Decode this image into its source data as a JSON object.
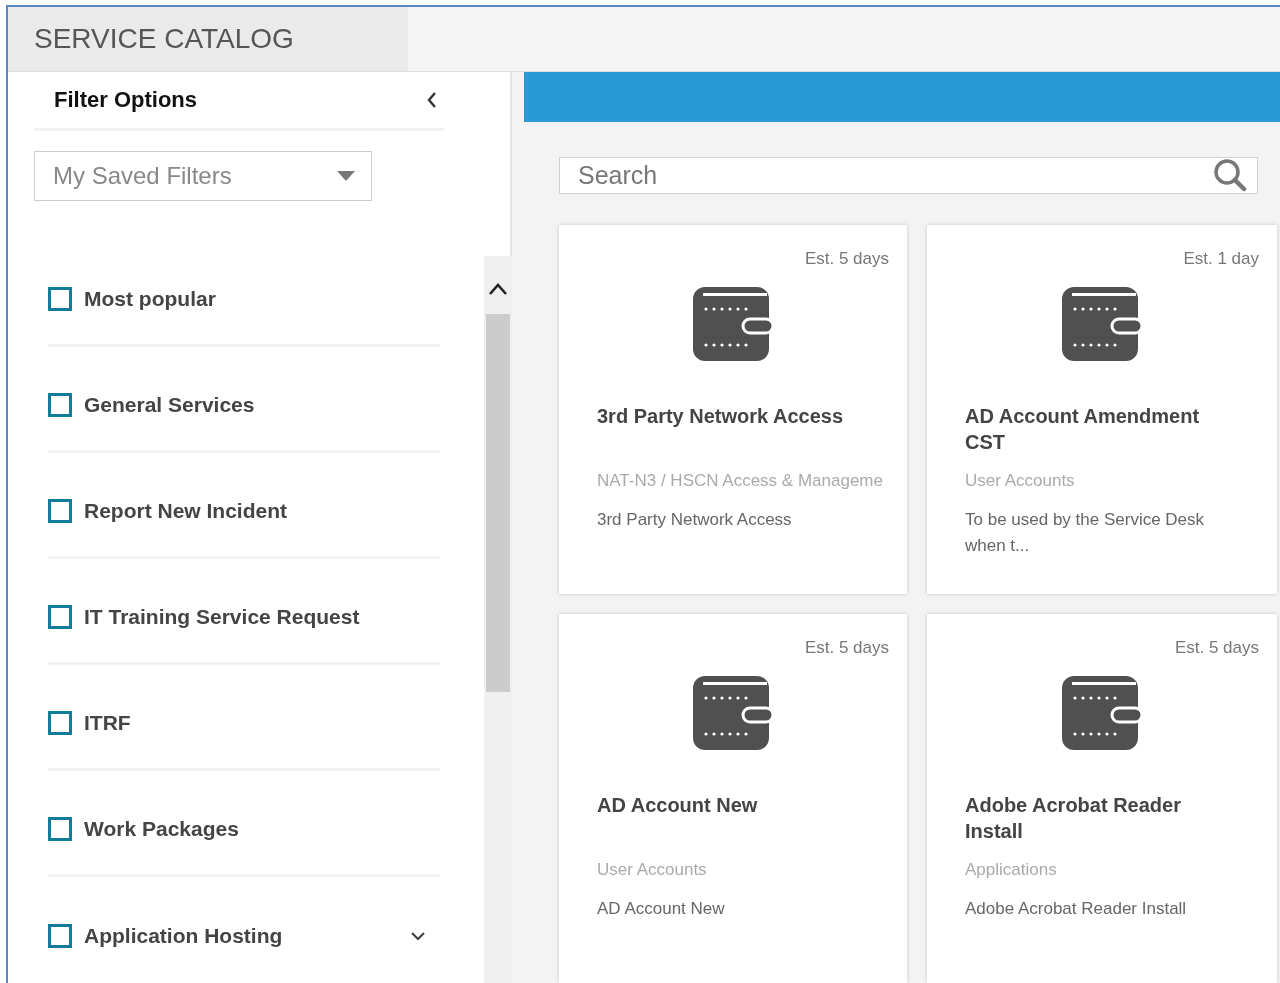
{
  "header": {
    "title": "SERVICE CATALOG"
  },
  "filter_panel": {
    "title": "Filter Options",
    "saved_filters": {
      "value": "My Saved Filters"
    },
    "items": [
      {
        "label": "Most popular",
        "checked": false
      },
      {
        "label": "General Services",
        "checked": false
      },
      {
        "label": "Report New Incident",
        "checked": false
      },
      {
        "label": "IT Training Service Request",
        "checked": false
      },
      {
        "label": "ITRF",
        "checked": false
      },
      {
        "label": "Work Packages",
        "checked": false
      },
      {
        "label": "Application Hosting",
        "checked": false,
        "expanded": false
      }
    ]
  },
  "search": {
    "placeholder": "Search"
  },
  "cards": [
    {
      "estimate": "Est. 5 days",
      "title": "3rd Party Network Access",
      "category": "NAT-N3 / HSCN Access & Manageme",
      "description": "3rd Party Network Access"
    },
    {
      "estimate": "Est. 1 day",
      "title": "AD Account Amendment CST",
      "category": "User Accounts",
      "description": "To be used by the Service Desk when t..."
    },
    {
      "estimate": "Est. 5 days",
      "title": "AD Account New",
      "category": "User Accounts",
      "description": "AD Account New"
    },
    {
      "estimate": "Est. 5 days",
      "title": "Adobe Acrobat Reader Install",
      "category": "Applications",
      "description": "Adobe Acrobat Reader Install"
    }
  ]
}
